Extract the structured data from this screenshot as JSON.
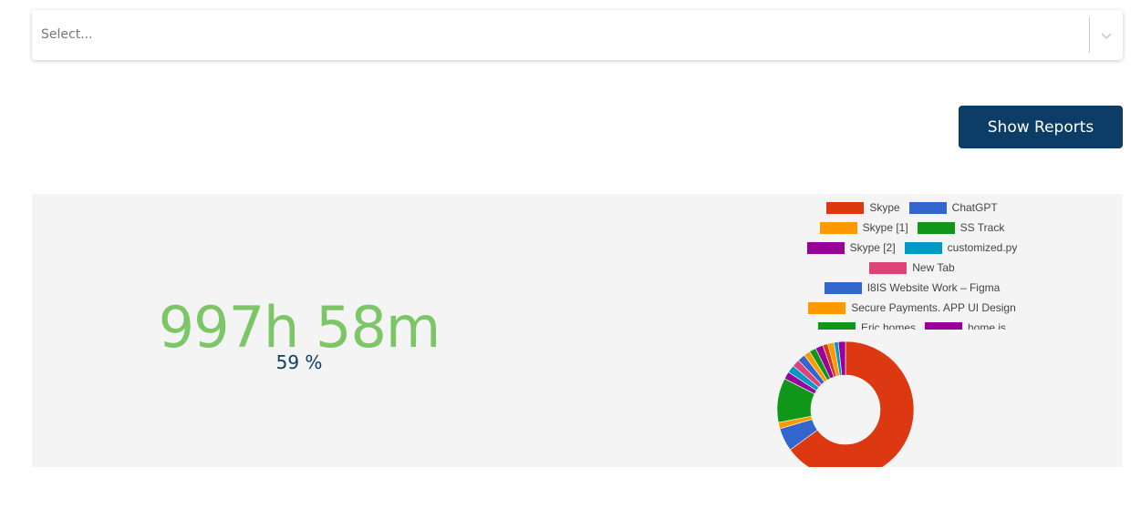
{
  "select": {
    "placeholder": "Select..."
  },
  "button": {
    "show_reports": "Show Reports"
  },
  "summary": {
    "total_time": "997h 58m",
    "percent": "59 %"
  },
  "icons": {
    "select_chevron": "chevron-down-icon"
  },
  "colors": {
    "accent_green": "#7cc667",
    "brand_navy": "#0c3d66",
    "panel_bg": "#f4f4f4"
  },
  "chart_data": {
    "type": "pie",
    "donut": true,
    "legend_position": "top",
    "labels": [
      "Skype",
      "ChatGPT",
      "Skype [1]",
      "SS Track",
      "Skype [2]",
      "customized.py",
      "New Tab",
      "I8IS Website Work – Figma",
      "Secure Payments. APP UI Design",
      "Eric homes",
      "home is",
      "",
      "",
      "",
      ""
    ],
    "values": [
      65.0,
      5.5,
      1.5,
      10.5,
      1.8,
      1.8,
      1.8,
      1.8,
      1.5,
      1.6,
      1.8,
      1.2,
      1.5,
      1.0,
      1.7
    ],
    "colors": [
      "#dc3912",
      "#3366cc",
      "#ff9900",
      "#109618",
      "#990099",
      "#0099c6",
      "#dd4477",
      "#3366cc",
      "#ff9900",
      "#109618",
      "#990099",
      "#dc3912",
      "#ff9900",
      "#0099c6",
      "#990099"
    ],
    "start_angle_deg": 0
  }
}
